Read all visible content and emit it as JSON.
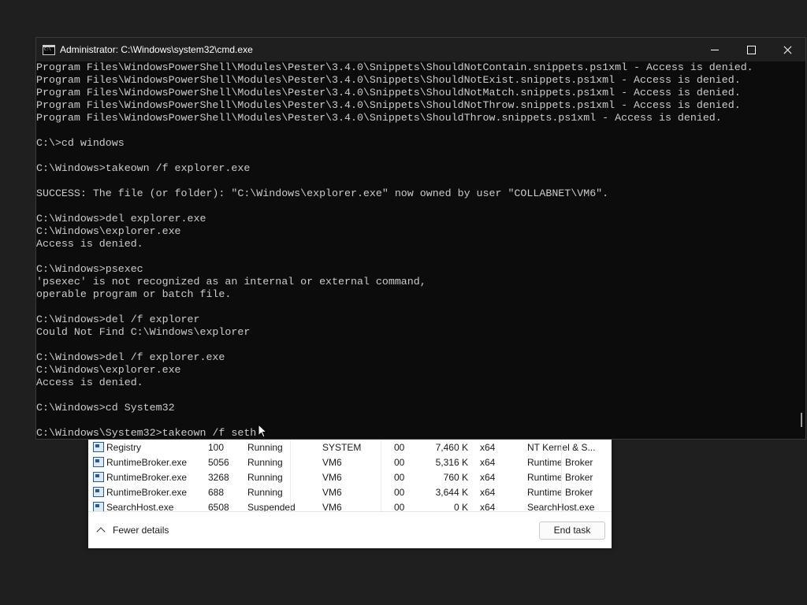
{
  "cmd": {
    "title": "Administrator: C:\\Windows\\system32\\cmd.exe",
    "lines": [
      "Program Files\\WindowsPowerShell\\Modules\\Pester\\3.4.0\\Snippets\\ShouldNotContain.snippets.ps1xml - Access is denied.",
      "Program Files\\WindowsPowerShell\\Modules\\Pester\\3.4.0\\Snippets\\ShouldNotExist.snippets.ps1xml - Access is denied.",
      "Program Files\\WindowsPowerShell\\Modules\\Pester\\3.4.0\\Snippets\\ShouldNotMatch.snippets.ps1xml - Access is denied.",
      "Program Files\\WindowsPowerShell\\Modules\\Pester\\3.4.0\\Snippets\\ShouldNotThrow.snippets.ps1xml - Access is denied.",
      "Program Files\\WindowsPowerShell\\Modules\\Pester\\3.4.0\\Snippets\\ShouldThrow.snippets.ps1xml - Access is denied.",
      "",
      "C:\\>cd windows",
      "",
      "C:\\Windows>takeown /f explorer.exe",
      "",
      "SUCCESS: The file (or folder): \"C:\\Windows\\explorer.exe\" now owned by user \"COLLABNET\\VM6\".",
      "",
      "C:\\Windows>del explorer.exe",
      "C:\\Windows\\explorer.exe",
      "Access is denied.",
      "",
      "C:\\Windows>psexec",
      "'psexec' is not recognized as an internal or external command,",
      "operable program or batch file.",
      "",
      "C:\\Windows>del /f explorer",
      "Could Not Find C:\\Windows\\explorer",
      "",
      "C:\\Windows>del /f explorer.exe",
      "C:\\Windows\\explorer.exe",
      "Access is denied.",
      "",
      "C:\\Windows>cd System32",
      "",
      "C:\\Windows\\System32>takeown /f seth"
    ]
  },
  "taskmgr": {
    "rows": [
      {
        "name": "Registry",
        "pid": "100",
        "status": "Running",
        "user": "SYSTEM",
        "cpu": "00",
        "mem": "7,460 K",
        "arch": "x64",
        "desc": "NT Kernel & S..."
      },
      {
        "name": "RuntimeBroker.exe",
        "pid": "5056",
        "status": "Running",
        "user": "VM6",
        "cpu": "00",
        "mem": "5,316 K",
        "arch": "x64",
        "desc": "Runtime Broker"
      },
      {
        "name": "RuntimeBroker.exe",
        "pid": "3268",
        "status": "Running",
        "user": "VM6",
        "cpu": "00",
        "mem": "760 K",
        "arch": "x64",
        "desc": "Runtime Broker"
      },
      {
        "name": "RuntimeBroker.exe",
        "pid": "688",
        "status": "Running",
        "user": "VM6",
        "cpu": "00",
        "mem": "3,644 K",
        "arch": "x64",
        "desc": "Runtime Broker"
      },
      {
        "name": "SearchHost.exe",
        "pid": "6508",
        "status": "Suspended",
        "user": "VM6",
        "cpu": "00",
        "mem": "0 K",
        "arch": "x64",
        "desc": "SearchHost.exe"
      }
    ],
    "fewer_details": "Fewer details",
    "end_task": "End task"
  },
  "colors": {
    "console_bg": "#0c0c0c",
    "console_text": "#cccccc",
    "titlebar": "#1f1f1f"
  },
  "icons": [
    "cmd-icon",
    "minimize-icon",
    "maximize-icon",
    "close-icon",
    "process-icon",
    "chevron-up-icon",
    "mouse-pointer-icon"
  ]
}
